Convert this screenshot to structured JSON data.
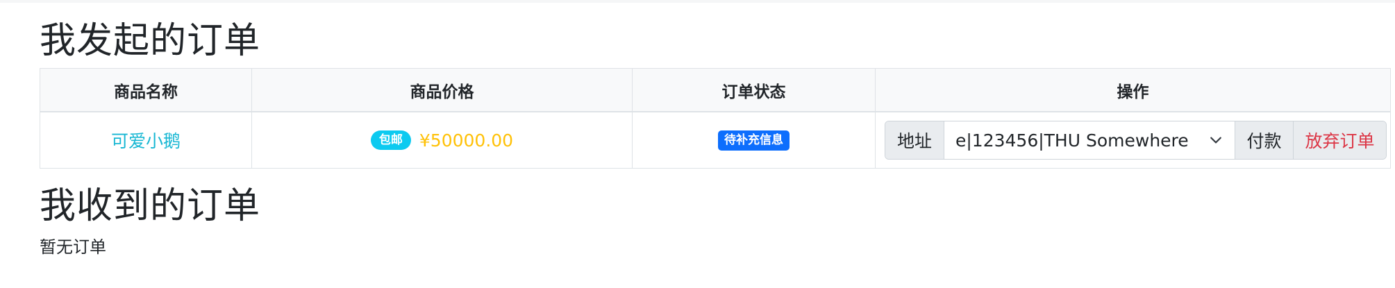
{
  "sent_section": {
    "title": "我发起的订单",
    "columns": [
      "商品名称",
      "商品价格",
      "订单状态",
      "操作"
    ],
    "rows": [
      {
        "product_name": "可爱小鹅",
        "shipping_badge": "包邮",
        "price": "¥50000.00",
        "status": "待补充信息",
        "address_label": "地址",
        "address_selected": "e|123456|THU Somewhere",
        "pay_label": "付款",
        "abandon_label": "放弃订单"
      }
    ]
  },
  "received_section": {
    "title": "我收到的订单",
    "empty_text": "暂无订单"
  },
  "icons": {
    "dropdown": "chevron-down-icon"
  },
  "colors": {
    "product_link": "#17b7d3",
    "price": "#ffc107",
    "shipping_badge": "#0dcaf0",
    "status_badge": "#0d6efd",
    "abandon_text": "#dc3545"
  }
}
